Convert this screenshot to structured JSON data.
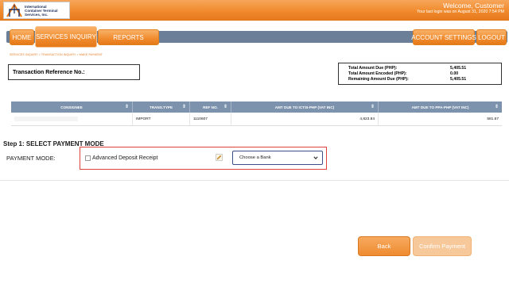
{
  "header": {
    "logo_text": "International\nContainer Terminal\nServices, Inc.",
    "welcome": "Welcome, Customer",
    "last_login": "Your last login was on August 31, 2020 7:54 PM"
  },
  "nav": {
    "home": "HOME",
    "services_inquiry": "SERVICES INQUIRY",
    "reports": "REPORTS",
    "account_settings": "ACCOUNT SETTINGS",
    "logout": "LOGOUT"
  },
  "breadcrumb": "SERVICES INQUIRY > TRANSACTION INQUIRY > MAKE PAYMENT",
  "reference": {
    "label": "Transaction Reference No.:"
  },
  "totals": [
    {
      "label": "Total Amount Due (PHP):",
      "value": "5,405.51"
    },
    {
      "label": "Total Amount Encoded (PHP):",
      "value": "0.00"
    },
    {
      "label": "Remaining Amount Due (PHP):",
      "value": "5,405.51"
    }
  ],
  "table": {
    "headers": [
      "CONSIGNEE",
      "TRANS.TYPE",
      "REF NO.",
      "AMT DUE TO ICTSI-PHP (VAT INC)",
      "AMT DUE TO PPA-PHP (VAT INC)"
    ],
    "rows": [
      {
        "consignee": "",
        "trans_type": "IMPORT",
        "ref_no": "1110607",
        "amt_ictsi": "4,823.84",
        "amt_ppa": "581.67"
      }
    ]
  },
  "step": {
    "title": "Step 1: SELECT PAYMENT MODE",
    "payment_mode_label": "PAYMENT MODE:",
    "checkbox_label": "Advanced Deposit Receipt",
    "bank_select_value": "Choose a Bank"
  },
  "actions": {
    "back": "Back",
    "confirm": "Confirm Payment"
  }
}
